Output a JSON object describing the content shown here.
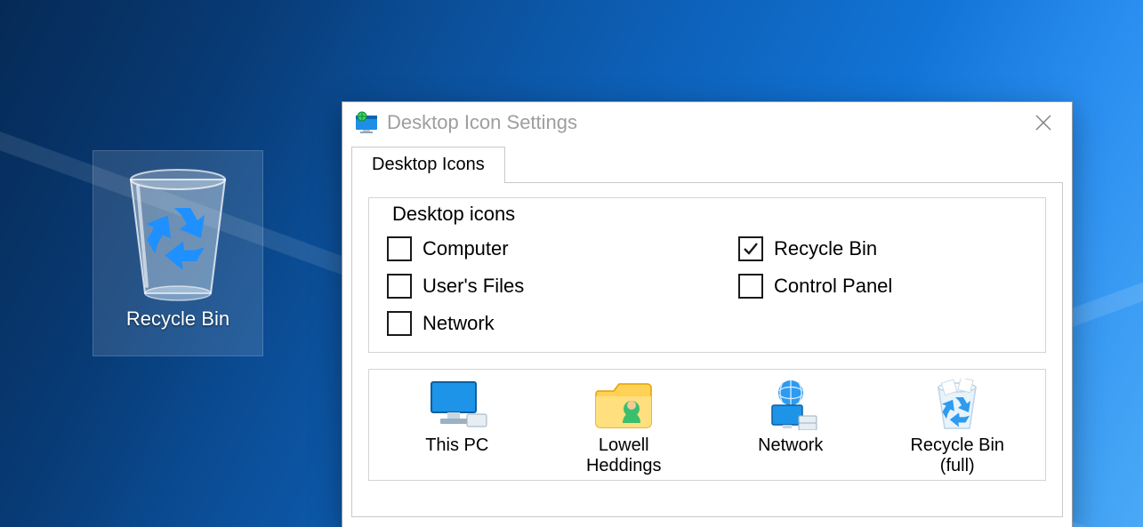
{
  "desktop_icon": {
    "label": "Recycle Bin"
  },
  "dialog": {
    "title": "Desktop Icon Settings",
    "tab_label": "Desktop Icons",
    "group_label": "Desktop icons",
    "checkboxes": {
      "computer": {
        "label": "Computer",
        "checked": false
      },
      "recycle_bin": {
        "label": "Recycle Bin",
        "checked": true
      },
      "users_files": {
        "label": "User's Files",
        "checked": false
      },
      "control_panel": {
        "label": "Control Panel",
        "checked": false
      },
      "network": {
        "label": "Network",
        "checked": false
      }
    },
    "preview": {
      "this_pc": "This PC",
      "user": "Lowell Heddings",
      "network": "Network",
      "recycle_full": "Recycle Bin (full)"
    }
  }
}
